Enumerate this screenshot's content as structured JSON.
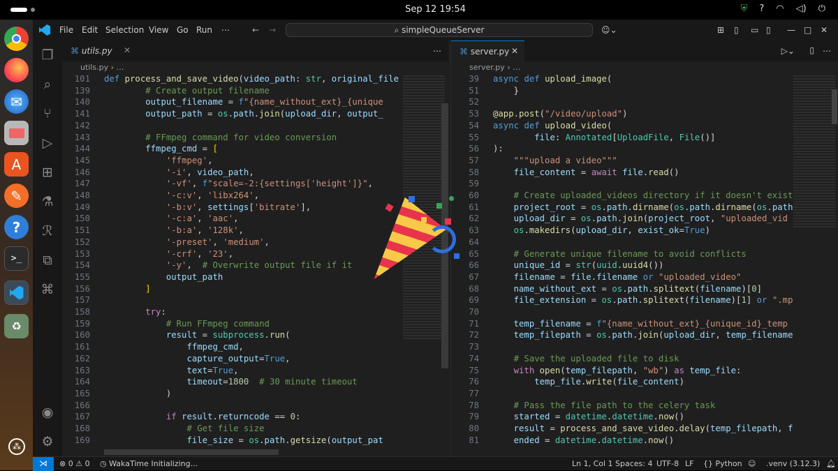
{
  "system": {
    "clock": "Sep 12  19:54",
    "tray_icons": [
      "shield-icon",
      "help-icon",
      "wifi-icon",
      "volume-icon",
      "power-icon"
    ]
  },
  "window": {
    "menu": [
      "File",
      "Edit",
      "Selection",
      "View",
      "Go",
      "Run",
      "⋯"
    ],
    "search": "⌕ simpleQueueServer"
  },
  "left": {
    "tab": "utils.py",
    "crumb": "utils.py › …",
    "sticky": "def process_and_save_video(video_path: str, original_file",
    "lines": [
      {
        "n": "101",
        "t": "<span class=\"kw\">def</span> <span class=\"fn\">process_and_save_video</span>(<span class=\"pr\">video_path</span>: <span class=\"ty\">str</span>, <span class=\"pr\">original_file</span>"
      },
      {
        "n": "139",
        "t": "        <span class=\"cm\"># Create output filename</span>"
      },
      {
        "n": "140",
        "t": "        <span class=\"pr\">output_filename</span> = <span class=\"kw\">f</span><span class=\"st\">\"{name_without_ext}_{unique</span>"
      },
      {
        "n": "141",
        "t": "        <span class=\"pr\">output_path</span> = <span class=\"ty\">os</span>.<span class=\"pr\">path</span>.<span class=\"fn\">join</span>(<span class=\"pr\">upload_dir</span>, <span class=\"pr\">output_</span>"
      },
      {
        "n": "142",
        "t": ""
      },
      {
        "n": "143",
        "t": "        <span class=\"cm\"># FFmpeg command for video conversion</span>"
      },
      {
        "n": "144",
        "t": "        <span class=\"pr\">ffmpeg_cmd</span> = <span class=\"br\">[</span>"
      },
      {
        "n": "145",
        "t": "            <span class=\"st\">'ffmpeg'</span>,"
      },
      {
        "n": "146",
        "t": "            <span class=\"st\">'-i'</span>, <span class=\"pr\">video_path</span>,"
      },
      {
        "n": "147",
        "t": "            <span class=\"st\">'-vf'</span>, <span class=\"kw\">f</span><span class=\"st\">\"scale=-2:{settings['height']}\"</span>,"
      },
      {
        "n": "148",
        "t": "            <span class=\"st\">'-c:v'</span>, <span class=\"st\">'libx264'</span>,"
      },
      {
        "n": "149",
        "t": "            <span class=\"st\">'-b:v'</span>, <span class=\"pr\">settings</span>[<span class=\"st\">'bitrate'</span>],"
      },
      {
        "n": "150",
        "t": "            <span class=\"st\">'-c:a'</span>, <span class=\"st\">'aac'</span>,"
      },
      {
        "n": "151",
        "t": "            <span class=\"st\">'-b:a'</span>, <span class=\"st\">'128k'</span>,"
      },
      {
        "n": "152",
        "t": "            <span class=\"st\">'-preset'</span>, <span class=\"st\">'medium'</span>,"
      },
      {
        "n": "153",
        "t": "            <span class=\"st\">'-crf'</span>, <span class=\"st\">'23'</span>,"
      },
      {
        "n": "154",
        "t": "            <span class=\"st\">'-y'</span>,  <span class=\"cm\"># Overwrite output file if it</span>"
      },
      {
        "n": "155",
        "t": "            <span class=\"pr\">output_path</span>"
      },
      {
        "n": "156",
        "t": "        <span class=\"br\">]</span>"
      },
      {
        "n": "157",
        "t": ""
      },
      {
        "n": "158",
        "t": "        <span class=\"kw2\">try</span>:"
      },
      {
        "n": "159",
        "t": "            <span class=\"cm\"># Run FFmpeg command</span>"
      },
      {
        "n": "160",
        "t": "            <span class=\"pr\">result</span> = <span class=\"ty\">subprocess</span>.<span class=\"fn\">run</span>("
      },
      {
        "n": "161",
        "t": "                <span class=\"pr\">ffmpeg_cmd</span>,"
      },
      {
        "n": "162",
        "t": "                <span class=\"pr\">capture_output</span>=<span class=\"kw\">True</span>,"
      },
      {
        "n": "163",
        "t": "                <span class=\"pr\">text</span>=<span class=\"kw\">True</span>,"
      },
      {
        "n": "164",
        "t": "                <span class=\"pr\">timeout</span>=<span class=\"nm\">1800</span>  <span class=\"cm\"># 30 minute timeout</span>"
      },
      {
        "n": "165",
        "t": "            )"
      },
      {
        "n": "166",
        "t": ""
      },
      {
        "n": "167",
        "t": "            <span class=\"kw2\">if</span> <span class=\"pr\">result</span>.<span class=\"pr\">returncode</span> == <span class=\"nm\">0</span>:"
      },
      {
        "n": "168",
        "t": "                <span class=\"cm\"># Get file size</span>"
      },
      {
        "n": "169",
        "t": "                <span class=\"pr\">file_size</span> = <span class=\"ty\">os</span>.<span class=\"pr\">path</span>.<span class=\"fn\">getsize</span>(<span class=\"pr\">output_pat</span>"
      }
    ]
  },
  "right": {
    "tab": "server.py",
    "crumb": "server.py › …",
    "lines": [
      {
        "n": "39",
        "t": "<span class=\"kw\">async</span> <span class=\"kw\">def</span> <span class=\"fn\">upload_image</span>("
      },
      {
        "n": "51",
        "t": "    }"
      },
      {
        "n": "52",
        "t": ""
      },
      {
        "n": "53",
        "t": "<span class=\"fn\">@app</span>.<span class=\"fn\">post</span>(<span class=\"st\">\"/video/upload\"</span>)"
      },
      {
        "n": "54",
        "t": "<span class=\"kw\">async</span> <span class=\"kw\">def</span> <span class=\"fn\">upload_video</span>("
      },
      {
        "n": "55",
        "t": "        <span class=\"pr\">file</span>: <span class=\"ty\">Annotated</span>[<span class=\"ty\">UploadFile</span>, <span class=\"ty\">File</span>()]"
      },
      {
        "n": "56",
        "t": "):"
      },
      {
        "n": "57",
        "t": "    <span class=\"st\">\"\"\"upload a video\"\"\"</span>"
      },
      {
        "n": "58",
        "t": "    <span class=\"pr\">file_content</span> = <span class=\"kw2\">await</span> <span class=\"pr\">file</span>.<span class=\"fn\">read</span>()"
      },
      {
        "n": "59",
        "t": ""
      },
      {
        "n": "60",
        "t": "    <span class=\"cm\"># Create uploaded_videos directory if it doesn't exist</span>"
      },
      {
        "n": "61",
        "t": "    <span class=\"pr\">project_root</span> = <span class=\"ty\">os</span>.<span class=\"pr\">path</span>.<span class=\"fn\">dirname</span>(<span class=\"ty\">os</span>.<span class=\"pr\">path</span>.<span class=\"fn\">dirname</span>(<span class=\"ty\">os</span>.<span class=\"pr\">path</span>"
      },
      {
        "n": "62",
        "t": "    <span class=\"pr\">upload_dir</span> = <span class=\"ty\">os</span>.<span class=\"pr\">path</span>.<span class=\"fn\">join</span>(<span class=\"pr\">project_root</span>, <span class=\"st\">\"uploaded_vid</span>"
      },
      {
        "n": "63",
        "t": "    <span class=\"ty\">os</span>.<span class=\"fn\">makedirs</span>(<span class=\"pr\">upload_dir</span>, <span class=\"pr\">exist_ok</span>=<span class=\"kw\">True</span>)"
      },
      {
        "n": "64",
        "t": ""
      },
      {
        "n": "65",
        "t": "    <span class=\"cm\"># Generate unique filename to avoid conflicts</span>"
      },
      {
        "n": "66",
        "t": "    <span class=\"pr\">unique_id</span> = <span class=\"ty\">str</span>(<span class=\"ty\">uuid</span>.<span class=\"fn\">uuid4</span>())"
      },
      {
        "n": "67",
        "t": "    <span class=\"pr\">filename</span> = <span class=\"pr\">file</span>.<span class=\"pr\">filename</span> <span class=\"kw\">or</span> <span class=\"st\">\"uploaded_video\"</span>"
      },
      {
        "n": "68",
        "t": "    <span class=\"pr\">name_without_ext</span> = <span class=\"ty\">os</span>.<span class=\"pr\">path</span>.<span class=\"fn\">splitext</span>(<span class=\"pr\">filename</span>)[<span class=\"nm\">0</span>]"
      },
      {
        "n": "69",
        "t": "    <span class=\"pr\">file_extension</span> = <span class=\"ty\">os</span>.<span class=\"pr\">path</span>.<span class=\"fn\">splitext</span>(<span class=\"pr\">filename</span>)[<span class=\"nm\">1</span>] <span class=\"kw\">or</span> <span class=\"st\">\".mp</span>"
      },
      {
        "n": "70",
        "t": ""
      },
      {
        "n": "71",
        "t": "    <span class=\"pr\">temp_filename</span> = <span class=\"kw\">f</span><span class=\"st\">\"{name_without_ext}_{unique_id}_temp</span>"
      },
      {
        "n": "72",
        "t": "    <span class=\"pr\">temp_filepath</span> = <span class=\"ty\">os</span>.<span class=\"pr\">path</span>.<span class=\"fn\">join</span>(<span class=\"pr\">upload_dir</span>, <span class=\"pr\">temp_filename</span>"
      },
      {
        "n": "73",
        "t": ""
      },
      {
        "n": "74",
        "t": "    <span class=\"cm\"># Save the uploaded file to disk</span>"
      },
      {
        "n": "75",
        "t": "    <span class=\"kw2\">with</span> <span class=\"fn\">open</span>(<span class=\"pr\">temp_filepath</span>, <span class=\"st\">\"wb\"</span>) <span class=\"kw2\">as</span> <span class=\"pr\">temp_file</span>:"
      },
      {
        "n": "76",
        "t": "        <span class=\"pr\">temp_file</span>.<span class=\"fn\">write</span>(<span class=\"pr\">file_content</span>)"
      },
      {
        "n": "77",
        "t": ""
      },
      {
        "n": "78",
        "t": "    <span class=\"cm\"># Pass the file path to the celery task</span>"
      },
      {
        "n": "79",
        "t": "    <span class=\"pr\">started</span> = <span class=\"ty\">datetime</span>.<span class=\"ty\">datetime</span>.<span class=\"fn\">now</span>()"
      },
      {
        "n": "80",
        "t": "    <span class=\"pr\">result</span> = <span class=\"fn\">process_and_save_video</span>.<span class=\"fn\">delay</span>(<span class=\"pr\">temp_filepath</span>, <span class=\"pr\">f</span>"
      },
      {
        "n": "81",
        "t": "    <span class=\"pr\">ended</span> = <span class=\"ty\">datetime</span>.<span class=\"ty\">datetime</span>.<span class=\"fn\">now</span>()"
      }
    ]
  },
  "status": {
    "problems": "⊗ 0 ⚠ 0",
    "wakatime": "WakaTime Initializing...",
    "position": "Ln 1, Col 1",
    "spaces": "Spaces: 4",
    "encoding": "UTF-8",
    "eol": "LF",
    "language": "{} Python",
    "venv": ".venv (3.12.3)"
  },
  "colors": {
    "accent": "#0078d4",
    "editor_bg": "#1f1f1f",
    "chrome_bg": "#181818"
  }
}
